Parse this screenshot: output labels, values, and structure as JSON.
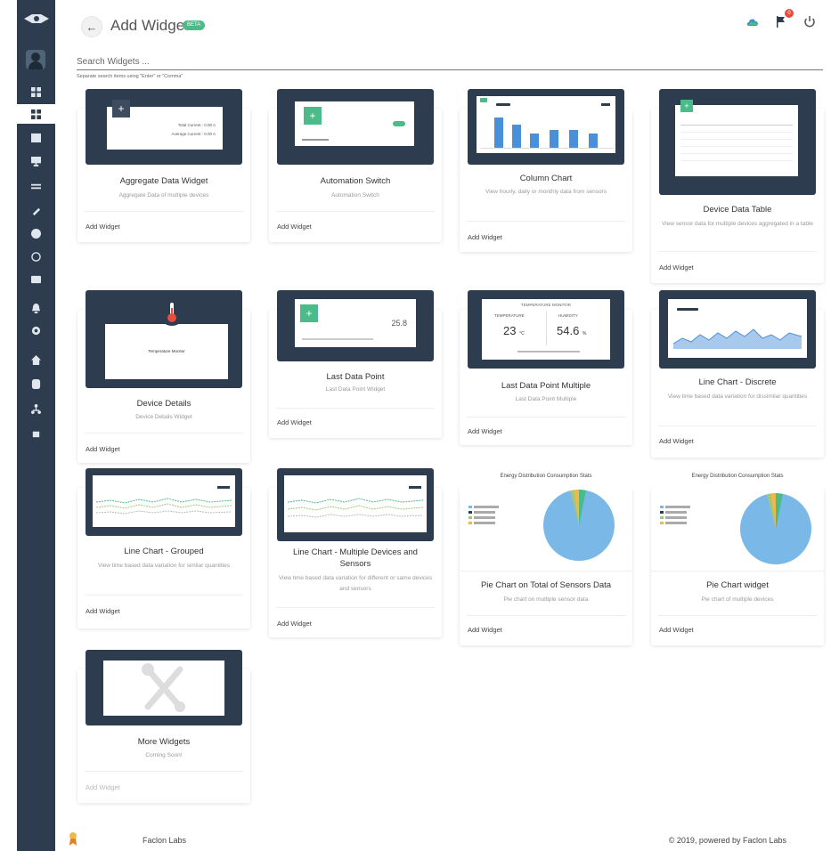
{
  "header": {
    "title": "Add Widget",
    "badge": "BETA"
  },
  "search": {
    "placeholder": "Search Widgets ...",
    "hint": "Separate search items using \"Enter\" or \"Comma\""
  },
  "widgets": [
    {
      "title": "Aggregate Data Widget",
      "description": "Aggregate Data of multiple devices",
      "action": "Add Widget"
    },
    {
      "title": "Automation Switch",
      "description": "Automation Switch",
      "action": "Add Widget"
    },
    {
      "title": "Column Chart",
      "description": "View hourly, daily or monthly data from sensors",
      "action": "Add Widget"
    },
    {
      "title": "Device Data Table",
      "description": "View sensor data for multiple devices aggregated in a table",
      "action": "Add Widget"
    },
    {
      "title": "Device Details",
      "description": "Device Details Widget",
      "action": "Add Widget"
    },
    {
      "title": "Last Data Point",
      "description": "Last Data Point Widget",
      "action": "Add Widget"
    },
    {
      "title": "Last Data Point Multiple",
      "description": "Last Data Point Multiple",
      "action": "Add Widget"
    },
    {
      "title": "Line Chart - Discrete",
      "description": "View time based data variation for dissimilar quantities",
      "action": "Add Widget"
    },
    {
      "title": "Line Chart - Grouped",
      "description": "View time based data variation for similar quantities",
      "action": "Add Widget"
    },
    {
      "title": "Line Chart - Multiple Devices and Sensors",
      "description": "View time based data variation for different or same devices and sensors",
      "action": "Add Widget"
    },
    {
      "title": "Pie Chart on Total of Sensors Data",
      "description": "Pie chart on multiple sensor data",
      "action": "Add Widget"
    },
    {
      "title": "Pie Chart widget",
      "description": "Pie chart of multiple devices",
      "action": "Add Widget"
    },
    {
      "title": "More Widgets",
      "description": "Coming Soon!",
      "action": "Add Widget"
    }
  ],
  "thumbs": {
    "aggregate": {
      "line1": "Total Current : 0.00 A",
      "line2": "Average Current : 0.00 A"
    },
    "last_multiple": {
      "heading": "TEMPERATURE MONITOR",
      "label_a": "TEMPERATURE",
      "label_b": "HUMIDITY",
      "value_a": "23",
      "unit_a": "°C",
      "value_b": "54.6",
      "unit_b": "%"
    },
    "last_point": {
      "value": "25.8"
    },
    "device_details": {
      "name": "Temperature Monitor"
    },
    "pie_title": "Energy Distribution Consumption Stats"
  },
  "footer": {
    "left": "Faclon Labs",
    "right": "© 2019, powered by Faclon Labs"
  },
  "colors": {
    "sidebar": "#2d3c4e",
    "accent": "#4cbb8a",
    "bar": "#4a90d9",
    "pie": "#7ab8e8"
  }
}
